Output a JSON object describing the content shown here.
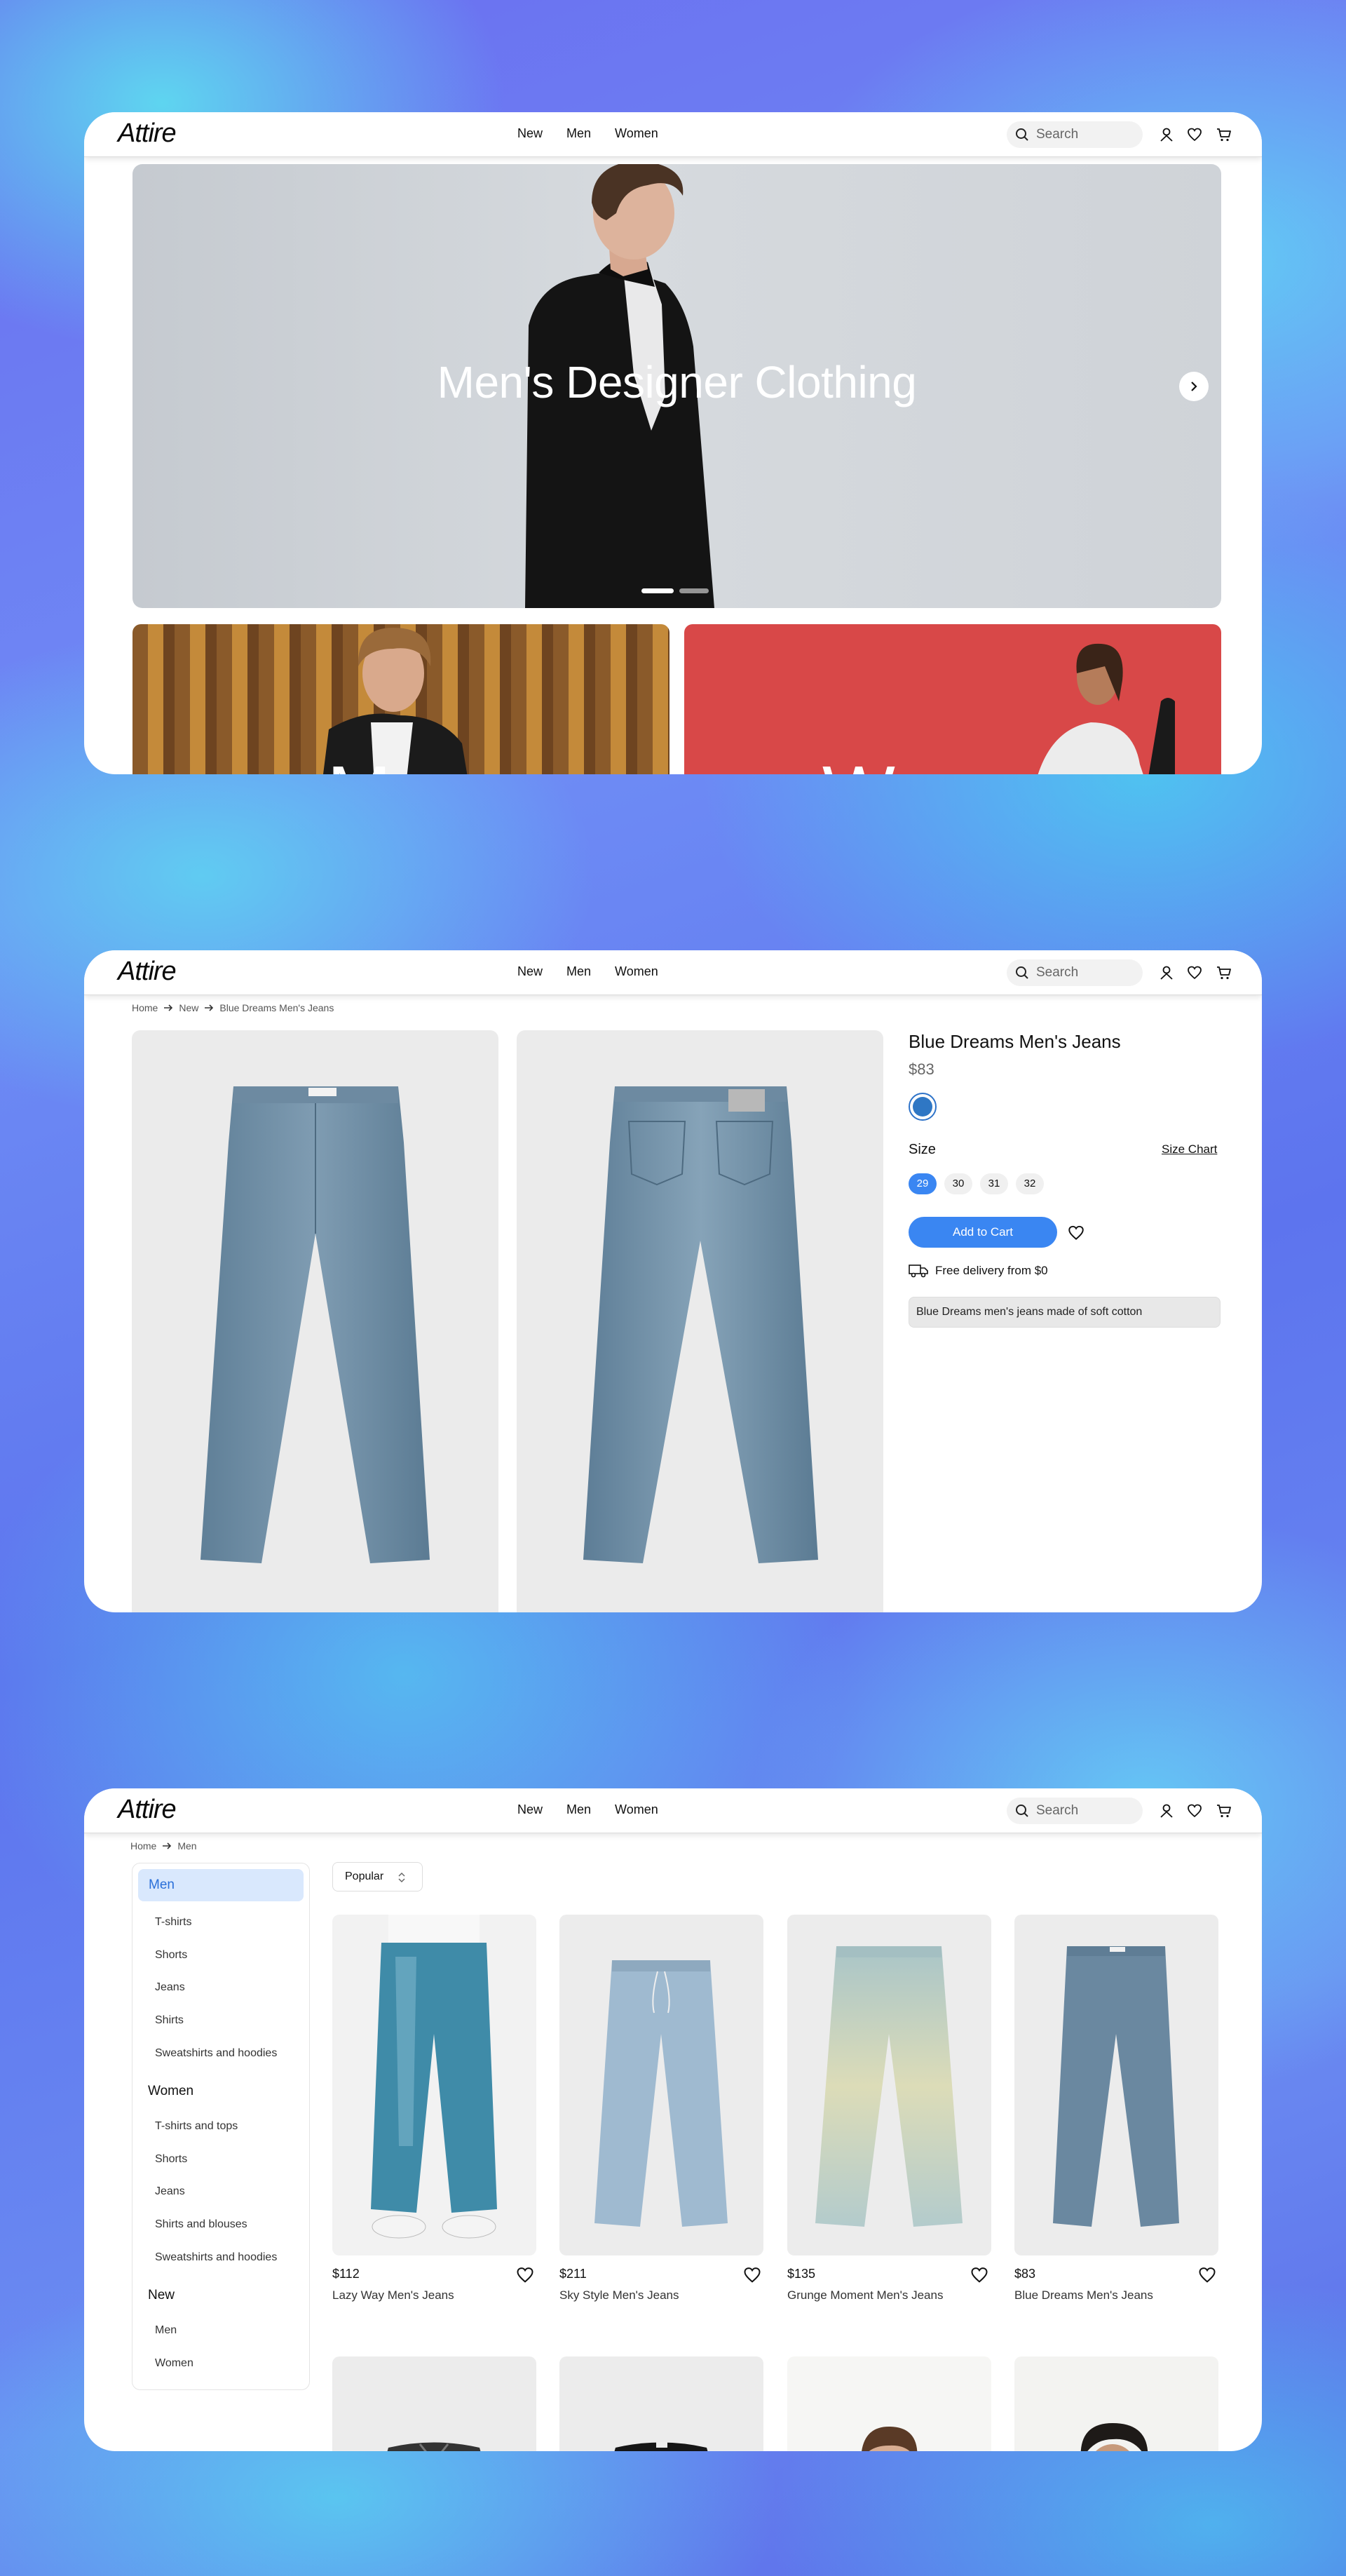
{
  "header": {
    "logo": "Attire",
    "nav": [
      "New",
      "Men",
      "Women"
    ],
    "search_placeholder": "Search"
  },
  "home": {
    "hero_title": "Men's Designer Clothing",
    "tiles": [
      "Men",
      "Women"
    ]
  },
  "product": {
    "breadcrumb": [
      "Home",
      "New",
      "Blue Dreams Men's Jeans"
    ],
    "title": "Blue Dreams Men's Jeans",
    "price": "$83",
    "color_swatch": "#2f77c4",
    "size_label": "Size",
    "size_chart": "Size Chart",
    "sizes": [
      "29",
      "30",
      "31",
      "32"
    ],
    "selected_size": "29",
    "add_to_cart": "Add to Cart",
    "delivery": "Free delivery from $0",
    "description": "Blue Dreams men's jeans made of soft cotton"
  },
  "catalog": {
    "breadcrumb": [
      "Home",
      "Men"
    ],
    "sort": "Popular",
    "sidebar": {
      "men_heading": "Men",
      "men_items": [
        "T-shirts",
        "Shorts",
        "Jeans",
        "Shirts",
        "Sweatshirts and hoodies"
      ],
      "women_heading": "Women",
      "women_items": [
        "T-shirts and tops",
        "Shorts",
        "Jeans",
        "Shirts and blouses",
        "Sweatshirts and hoodies"
      ],
      "new_heading": "New",
      "new_items": [
        "Men",
        "Women"
      ]
    },
    "products": [
      {
        "price": "$112",
        "name": "Lazy Way Men's Jeans"
      },
      {
        "price": "$211",
        "name": "Sky Style Men's Jeans"
      },
      {
        "price": "$135",
        "name": "Grunge Moment Men's Jeans"
      },
      {
        "price": "$83",
        "name": "Blue Dreams Men's Jeans"
      }
    ]
  },
  "colors": {
    "accent": "#3a86f2",
    "accent_light": "#d9e8fd"
  }
}
